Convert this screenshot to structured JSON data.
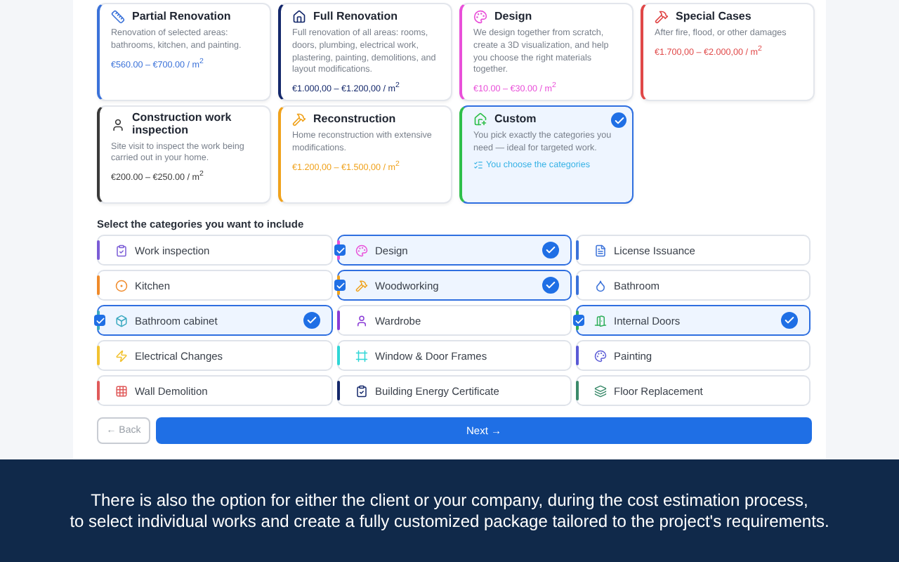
{
  "packages": [
    {
      "title": "Partial Renovation",
      "kind": "ruler",
      "description": "Renovation of selected areas: bathrooms, kitchen, and painting.",
      "price": "€560.00 – €700.00 / m$^{2}$",
      "color": "#3b72d9",
      "selected": false
    },
    {
      "title": "Full Renovation",
      "kind": "home",
      "description": "Full renovation of all areas: rooms, doors, plumbing, electrical work, plastering, painting, demolitions, and layout modifications.",
      "price": "€1.000,00 – €1.200,00 / m$^{2}$",
      "color": "#14286b",
      "selected": false
    },
    {
      "title": "Design",
      "kind": "palette",
      "description": "We design together from scratch, create a 3D visualization, and help you choose the right materials together.",
      "price": "€10.00 – €30.00 / m$^{2}$",
      "color": "#e94fd9",
      "selected": false
    },
    {
      "title": "Special Cases",
      "kind": "hammer",
      "description": "After fire, flood, or other damages",
      "price": "€1.700,00 – €2.000,00 / m$^{2}$",
      "color": "#e04848",
      "selected": false
    },
    {
      "title": "Construction work inspection",
      "kind": "user",
      "description": "Site visit to inspect the work being carried out in your home.",
      "price": "€200.00 – €250.00 / m$^{2}$",
      "color": "#3a3a3a",
      "selected": false
    },
    {
      "title": "Reconstruction",
      "kind": "hammer",
      "description": "Home reconstruction with extensive modifications.",
      "price": "€1.200,00 – €1.500,00 / m$^{2}$",
      "color": "#f0a21c",
      "selected": false
    },
    {
      "title": "Custom",
      "kind": "house-plus",
      "description": "You pick exactly the categories you need — ideal for targeted work.",
      "link": "You choose the categories",
      "color": "#2fbf4a",
      "selected": true
    }
  ],
  "categories_heading": "Select the categories you want to include",
  "categories": [
    {
      "label": "Work inspection",
      "kind": "clipboard",
      "color": "#7b5cd6",
      "selected": false
    },
    {
      "label": "Design",
      "kind": "palette",
      "color": "#e94fd9",
      "selected": true
    },
    {
      "label": "License Issuance",
      "kind": "file",
      "color": "#3b72d9",
      "selected": false
    },
    {
      "label": "Kitchen",
      "kind": "circle-dot",
      "color": "#f08a2a",
      "selected": false
    },
    {
      "label": "Woodworking",
      "kind": "hammer",
      "color": "#f0a21c",
      "selected": true
    },
    {
      "label": "Bathroom",
      "kind": "droplet",
      "color": "#3b72d9",
      "selected": false
    },
    {
      "label": "Bathroom cabinet",
      "kind": "box",
      "color": "#3aa9c0",
      "selected": true
    },
    {
      "label": "Wardrobe",
      "kind": "user",
      "color": "#8a3cd6",
      "selected": false
    },
    {
      "label": "Internal Doors",
      "kind": "door",
      "color": "#2fae5a",
      "selected": true
    },
    {
      "label": "Electrical Changes",
      "kind": "zap",
      "color": "#f2c230",
      "selected": false
    },
    {
      "label": "Window & Door Frames",
      "kind": "frame",
      "color": "#2fd6d6",
      "selected": false
    },
    {
      "label": "Painting",
      "kind": "palette",
      "color": "#5a5ad6",
      "selected": false
    },
    {
      "label": "Wall Demolition",
      "kind": "grid",
      "color": "#e05a5a",
      "selected": false
    },
    {
      "label": "Building Energy Certificate",
      "kind": "clipboard",
      "color": "#14286b",
      "selected": false
    },
    {
      "label": "Floor Replacement",
      "kind": "layers",
      "color": "#3a8a6a",
      "selected": false
    }
  ],
  "back_button": "← Back",
  "next_button": "Next →",
  "caption": [
    "There is also the option for either the client or your company, during the cost estimation process,",
    "to select individual works and create a fully customized package tailored to the project's requirements."
  ]
}
